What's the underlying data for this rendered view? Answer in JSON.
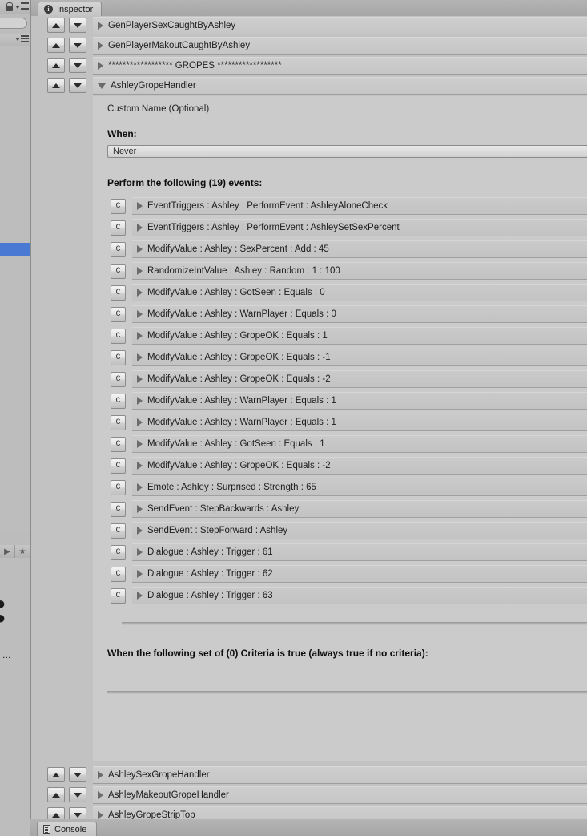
{
  "window": {
    "inspector_tab": "Inspector",
    "inspector_icon": "info-circle-icon",
    "console_tab": "Console",
    "console_icon": "document-list-icon"
  },
  "left_panels": {
    "lock_icon": "lock-icon",
    "menu_icon": "hamburger-menu-icon",
    "star_icon": "star-icon",
    "back_icon": "back-arrow-icon",
    "fragment_text": "- …"
  },
  "components_above": [
    {
      "label": "GenPlayerSexCaughtByAshley",
      "expanded": false
    },
    {
      "label": "GenPlayerMakoutCaughtByAshley",
      "expanded": false
    },
    {
      "label": "****************** GROPES ******************",
      "expanded": false
    }
  ],
  "active_component": {
    "label": "AshleyGropeHandler",
    "expanded": true,
    "custom_name_label": "Custom Name (Optional)",
    "when_label": "When:",
    "when_value": "Never",
    "events_title": "Perform the following (19) events:",
    "copy_button_label": "C",
    "events": [
      "EventTriggers : Ashley : PerformEvent : AshleyAloneCheck",
      "EventTriggers : Ashley : PerformEvent : AshleySetSexPercent",
      "ModifyValue : Ashley : SexPercent : Add : 45",
      "RandomizeIntValue : Ashley : Random : 1 : 100",
      "ModifyValue : Ashley : GotSeen : Equals : 0",
      "ModifyValue : Ashley : WarnPlayer : Equals : 0",
      "ModifyValue : Ashley : GropeOK : Equals : 1",
      "ModifyValue : Ashley : GropeOK : Equals : -1",
      "ModifyValue : Ashley : GropeOK : Equals : -2",
      "ModifyValue : Ashley : WarnPlayer : Equals : 1",
      "ModifyValue : Ashley : WarnPlayer : Equals : 1",
      "ModifyValue : Ashley : GotSeen : Equals : 1",
      "ModifyValue : Ashley : GropeOK : Equals : -2",
      "Emote : Ashley : Surprised : Strength : 65",
      "SendEvent : StepBackwards : Ashley",
      "SendEvent : StepForward : Ashley",
      "Dialogue : Ashley : Trigger : 61",
      "Dialogue : Ashley : Trigger : 62",
      "Dialogue : Ashley : Trigger : 63"
    ],
    "criteria_title": "When the following set of (0) Criteria is true (always true if no criteria):"
  },
  "components_below": [
    {
      "label": "AshleySexGropeHandler",
      "expanded": false
    },
    {
      "label": "AshleyMakeoutGropeHandler",
      "expanded": false
    },
    {
      "label": "AshleyGropeStripTop",
      "expanded": false
    }
  ],
  "colors": {
    "panel_bg": "#c2c2c2",
    "row_bg": "#c8c8c8",
    "selection_blue": "#4a79d4",
    "text": "#1d1d1d"
  }
}
